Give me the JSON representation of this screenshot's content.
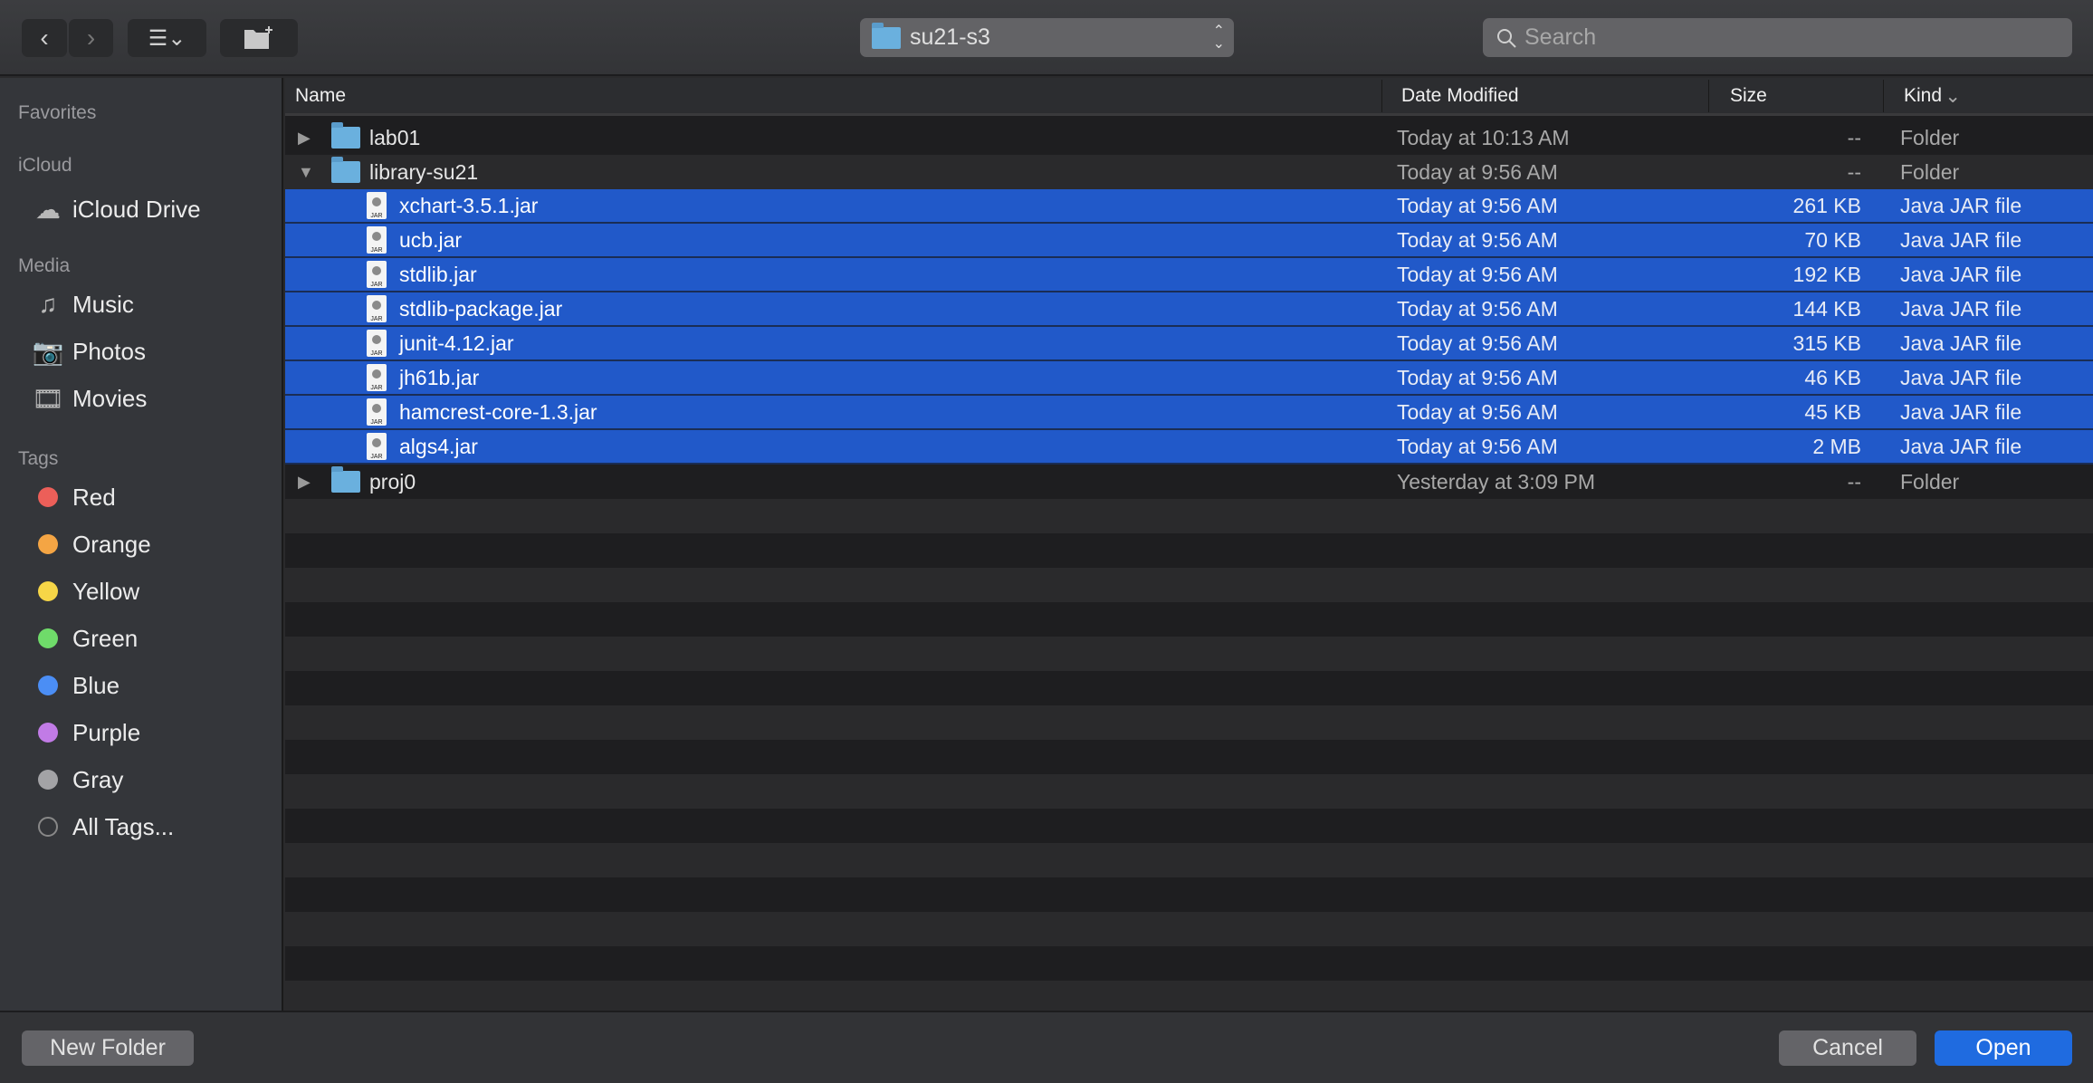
{
  "toolbar": {
    "back_icon": "chevron-left-icon",
    "forward_icon": "chevron-right-icon",
    "view_icon": "list-view-icon",
    "new_folder_icon": "new-folder-icon",
    "location": "su21-s3",
    "search_placeholder": "Search"
  },
  "sidebar": {
    "sections": [
      {
        "title": "Favorites",
        "items": []
      },
      {
        "title": "iCloud",
        "items": [
          {
            "label": "iCloud Drive",
            "icon": "cloud-icon"
          }
        ]
      },
      {
        "title": "Media",
        "items": [
          {
            "label": "Music",
            "icon": "music-icon"
          },
          {
            "label": "Photos",
            "icon": "camera-icon"
          },
          {
            "label": "Movies",
            "icon": "film-icon"
          }
        ]
      },
      {
        "title": "Tags",
        "items": [
          {
            "label": "Red",
            "color": "#ec5f59"
          },
          {
            "label": "Orange",
            "color": "#f4a544"
          },
          {
            "label": "Yellow",
            "color": "#f6d647"
          },
          {
            "label": "Green",
            "color": "#6fdb6a"
          },
          {
            "label": "Blue",
            "color": "#4b8ef5"
          },
          {
            "label": "Purple",
            "color": "#c17be6"
          },
          {
            "label": "Gray",
            "color": "#a3a3a6"
          },
          {
            "label": "All Tags...",
            "color": ""
          }
        ]
      }
    ]
  },
  "columns": {
    "name": "Name",
    "date": "Date Modified",
    "size": "Size",
    "kind": "Kind",
    "sort_icon": "chevron-down-icon"
  },
  "files": [
    {
      "name": "lab01",
      "date": "Today at 10:13 AM",
      "size": "--",
      "kind": "Folder",
      "type": "folder",
      "level": 0,
      "expanded": false,
      "selected": false
    },
    {
      "name": "library-su21",
      "date": "Today at 9:56 AM",
      "size": "--",
      "kind": "Folder",
      "type": "folder",
      "level": 0,
      "expanded": true,
      "selected": false
    },
    {
      "name": "xchart-3.5.1.jar",
      "date": "Today at 9:56 AM",
      "size": "261 KB",
      "kind": "Java JAR file",
      "type": "jar",
      "level": 1,
      "selected": true
    },
    {
      "name": "ucb.jar",
      "date": "Today at 9:56 AM",
      "size": "70 KB",
      "kind": "Java JAR file",
      "type": "jar",
      "level": 1,
      "selected": true
    },
    {
      "name": "stdlib.jar",
      "date": "Today at 9:56 AM",
      "size": "192 KB",
      "kind": "Java JAR file",
      "type": "jar",
      "level": 1,
      "selected": true
    },
    {
      "name": "stdlib-package.jar",
      "date": "Today at 9:56 AM",
      "size": "144 KB",
      "kind": "Java JAR file",
      "type": "jar",
      "level": 1,
      "selected": true
    },
    {
      "name": "junit-4.12.jar",
      "date": "Today at 9:56 AM",
      "size": "315 KB",
      "kind": "Java JAR file",
      "type": "jar",
      "level": 1,
      "selected": true
    },
    {
      "name": "jh61b.jar",
      "date": "Today at 9:56 AM",
      "size": "46 KB",
      "kind": "Java JAR file",
      "type": "jar",
      "level": 1,
      "selected": true
    },
    {
      "name": "hamcrest-core-1.3.jar",
      "date": "Today at 9:56 AM",
      "size": "45 KB",
      "kind": "Java JAR file",
      "type": "jar",
      "level": 1,
      "selected": true
    },
    {
      "name": "algs4.jar",
      "date": "Today at 9:56 AM",
      "size": "2 MB",
      "kind": "Java JAR file",
      "type": "jar",
      "level": 1,
      "selected": true
    },
    {
      "name": "proj0",
      "date": "Yesterday at 3:09 PM",
      "size": "--",
      "kind": "Folder",
      "type": "folder",
      "level": 0,
      "expanded": false,
      "selected": false
    }
  ],
  "jar_badge": "JAR",
  "footer": {
    "new_folder": "New Folder",
    "cancel": "Cancel",
    "open": "Open",
    "accent": "#1f6be0"
  }
}
